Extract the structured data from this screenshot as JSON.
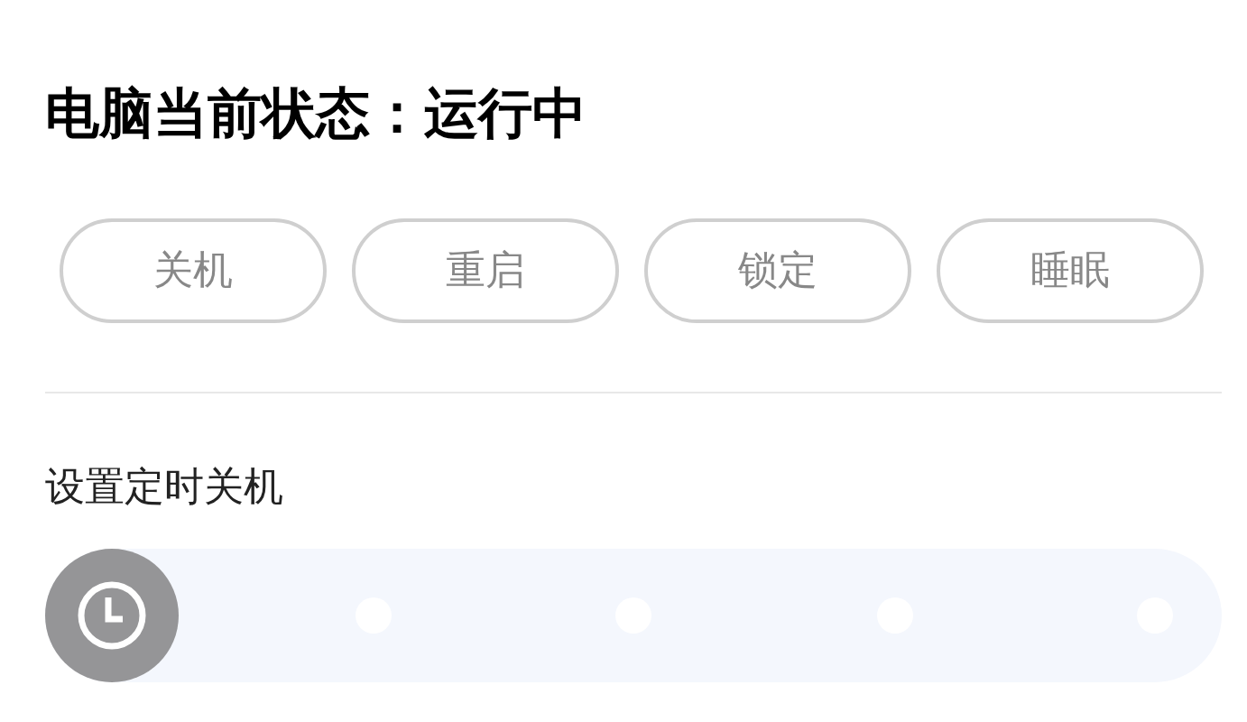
{
  "status_title": "电脑当前状态：运行中",
  "actions": [
    {
      "label": "关机"
    },
    {
      "label": "重启"
    },
    {
      "label": "锁定"
    },
    {
      "label": "睡眠"
    }
  ],
  "timer": {
    "label": "设置定时关机",
    "level": 0
  }
}
